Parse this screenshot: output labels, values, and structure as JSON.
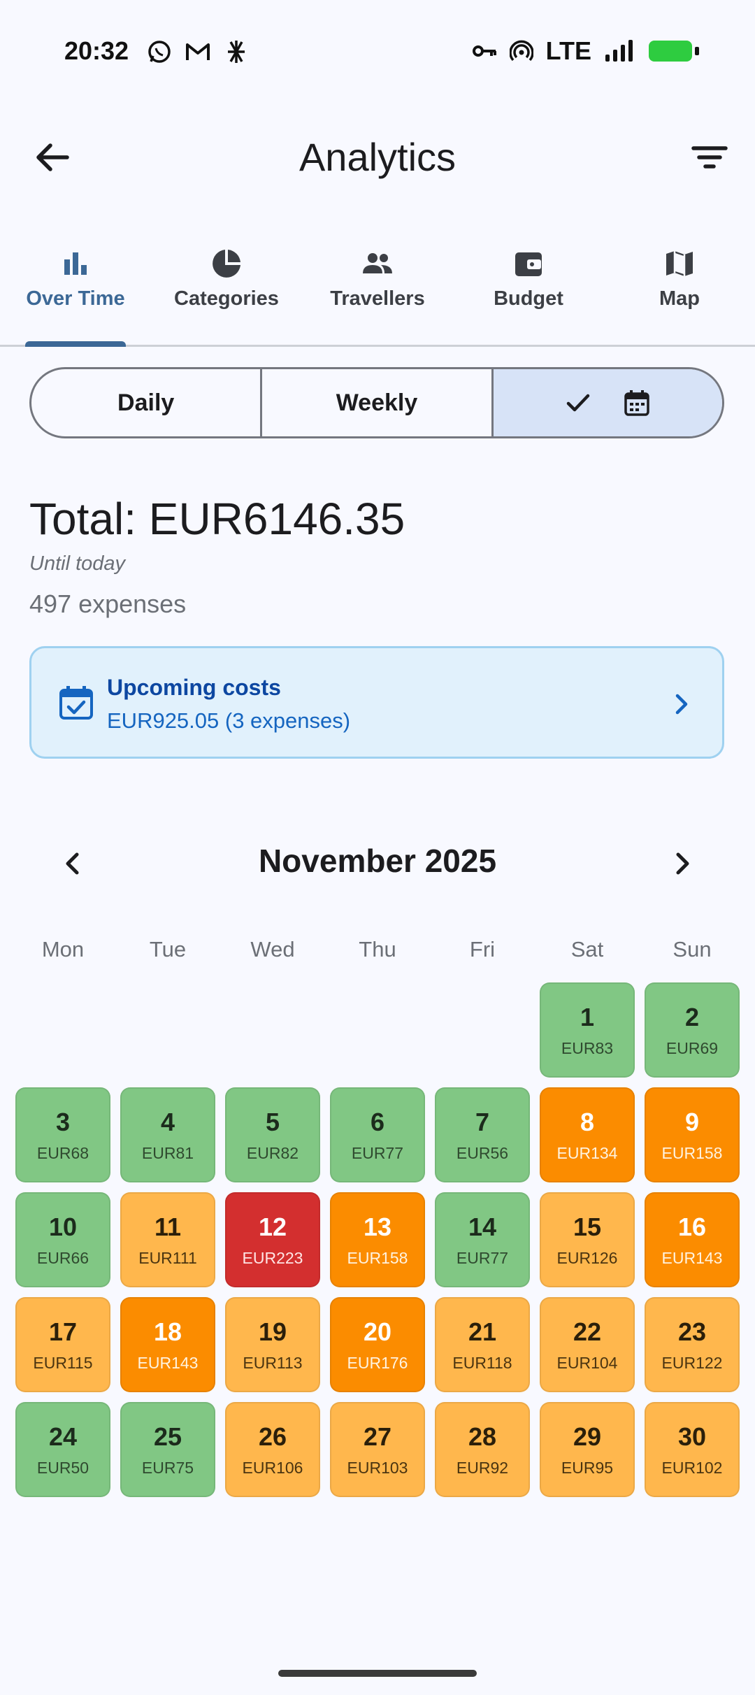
{
  "status_bar": {
    "time": "20:32",
    "network": "LTE"
  },
  "header": {
    "title": "Analytics"
  },
  "tabs": [
    {
      "label": "Over Time",
      "icon": "bar-chart-icon",
      "active": true
    },
    {
      "label": "Categories",
      "icon": "pie-chart-icon",
      "active": false
    },
    {
      "label": "Travellers",
      "icon": "people-icon",
      "active": false
    },
    {
      "label": "Budget",
      "icon": "wallet-icon",
      "active": false
    },
    {
      "label": "Map",
      "icon": "map-icon",
      "active": false
    }
  ],
  "segments": {
    "daily": "Daily",
    "weekly": "Weekly",
    "calendar_selected": true
  },
  "summary": {
    "total": "Total: EUR6146.35",
    "until": "Until today",
    "count": "497 expenses"
  },
  "upcoming": {
    "title": "Upcoming costs",
    "subtitle": "EUR925.05 (3 expenses)"
  },
  "calendar": {
    "month": "November 2025",
    "weekdays": [
      "Mon",
      "Tue",
      "Wed",
      "Thu",
      "Fri",
      "Sat",
      "Sun"
    ],
    "colors": {
      "low": "#81c784",
      "medium": "#ffb74d",
      "high": "#fb8c00",
      "peak": "#d32f2f"
    },
    "leading_blanks": 5,
    "days": [
      {
        "day": "1",
        "amount": "EUR83",
        "level": "green"
      },
      {
        "day": "2",
        "amount": "EUR69",
        "level": "green"
      },
      {
        "day": "3",
        "amount": "EUR68",
        "level": "green"
      },
      {
        "day": "4",
        "amount": "EUR81",
        "level": "green"
      },
      {
        "day": "5",
        "amount": "EUR82",
        "level": "green"
      },
      {
        "day": "6",
        "amount": "EUR77",
        "level": "green"
      },
      {
        "day": "7",
        "amount": "EUR56",
        "level": "green"
      },
      {
        "day": "8",
        "amount": "EUR134",
        "level": "orange"
      },
      {
        "day": "9",
        "amount": "EUR158",
        "level": "orange"
      },
      {
        "day": "10",
        "amount": "EUR66",
        "level": "green"
      },
      {
        "day": "11",
        "amount": "EUR111",
        "level": "amber"
      },
      {
        "day": "12",
        "amount": "EUR223",
        "level": "red"
      },
      {
        "day": "13",
        "amount": "EUR158",
        "level": "orange"
      },
      {
        "day": "14",
        "amount": "EUR77",
        "level": "green"
      },
      {
        "day": "15",
        "amount": "EUR126",
        "level": "amber"
      },
      {
        "day": "16",
        "amount": "EUR143",
        "level": "orange"
      },
      {
        "day": "17",
        "amount": "EUR115",
        "level": "amber"
      },
      {
        "day": "18",
        "amount": "EUR143",
        "level": "orange"
      },
      {
        "day": "19",
        "amount": "EUR113",
        "level": "amber"
      },
      {
        "day": "20",
        "amount": "EUR176",
        "level": "orange"
      },
      {
        "day": "21",
        "amount": "EUR118",
        "level": "amber"
      },
      {
        "day": "22",
        "amount": "EUR104",
        "level": "amber"
      },
      {
        "day": "23",
        "amount": "EUR122",
        "level": "amber"
      },
      {
        "day": "24",
        "amount": "EUR50",
        "level": "green"
      },
      {
        "day": "25",
        "amount": "EUR75",
        "level": "green"
      },
      {
        "day": "26",
        "amount": "EUR106",
        "level": "amber"
      },
      {
        "day": "27",
        "amount": "EUR103",
        "level": "amber"
      },
      {
        "day": "28",
        "amount": "EUR92",
        "level": "amber"
      },
      {
        "day": "29",
        "amount": "EUR95",
        "level": "amber"
      },
      {
        "day": "30",
        "amount": "EUR102",
        "level": "amber"
      }
    ]
  }
}
